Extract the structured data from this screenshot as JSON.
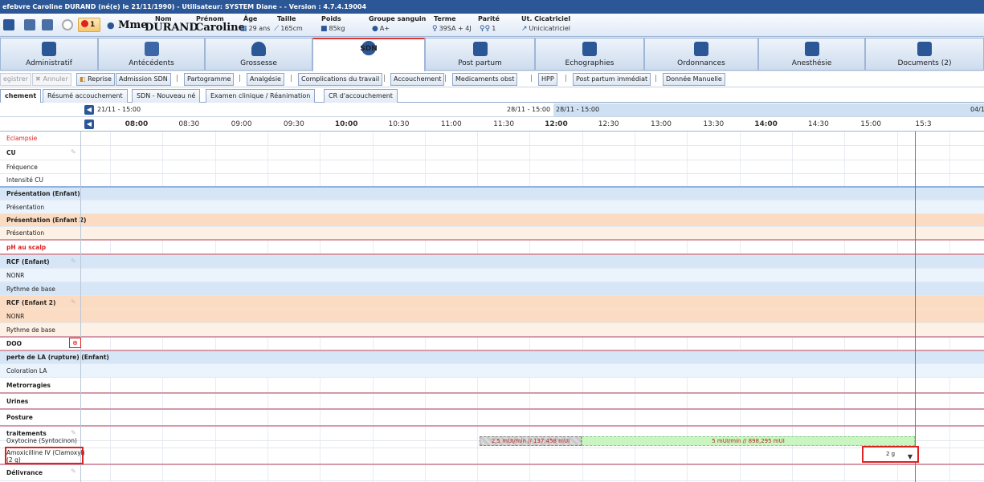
{
  "window": {
    "title": "efebvre Caroline DURAND (né(e) le 21/11/1990) - Utilisateur: SYSTEM Diane - - Version : 4.7.4.19004"
  },
  "patient": {
    "alert_count": "1",
    "civility": "Mme",
    "nom_label": "Nom",
    "nom": "DURAND",
    "prenom_label": "Prénom",
    "prenom": "Caroline",
    "age_label": "Âge",
    "age": "29 ans",
    "taille_label": "Taille",
    "taille": "165cm",
    "poids_label": "Poids",
    "poids": "85kg",
    "groupe_label": "Groupe sanguin",
    "groupe": "A+",
    "terme_label": "Terme",
    "terme": "39SA + 4J",
    "parite_label": "Parité",
    "parite": "1",
    "uterus_label": "Ut. Cicatriciel",
    "uterus": "Unicicatriciel"
  },
  "main_tabs": [
    {
      "label": "Administratif",
      "icon": "id-card-icon"
    },
    {
      "label": "Antécédents",
      "icon": "clock-calendar-icon"
    },
    {
      "label": "Grossesse",
      "icon": "pregnant-woman-icon"
    },
    {
      "label": "SDN",
      "icon": "footprints-icon"
    },
    {
      "label": "Post partum",
      "icon": "mother-baby-icon"
    },
    {
      "label": "Echographies",
      "icon": "ultrasound-icon"
    },
    {
      "label": "Ordonnances",
      "icon": "medical-cross-icon"
    },
    {
      "label": "Anesthésie",
      "icon": "anesthesia-monitor-icon"
    },
    {
      "label": "Documents (2)",
      "icon": "documents-icon"
    }
  ],
  "actions": {
    "save": "egistrer",
    "cancel": "Annuler",
    "reprise": "Reprise",
    "admission": "Admission SDN",
    "partogramme": "Partogramme",
    "analgesie": "Analgésie",
    "complications": "Complications du travail",
    "accouchement": "Accouchement",
    "medicaments": "Medicaments obst",
    "hpp": "HPP",
    "post_partum": "Post partum immédiat",
    "manuelle": "Donnée Manuelle"
  },
  "sub_tabs": [
    "chement",
    "Résumé accouchement",
    "SDN - Nouveau né",
    "Examen clinique / Réanimation",
    "CR d'accouchement"
  ],
  "timeline": {
    "day1": "21/11 - 15:00",
    "day2_end": "28/11 - 15:00",
    "day2_start": "28/11 - 15:00",
    "day3": "04/1",
    "ticks": [
      {
        "label": "08:00",
        "hour": true
      },
      {
        "label": "08:30",
        "hour": false
      },
      {
        "label": "09:00",
        "hour": false
      },
      {
        "label": "09:30",
        "hour": false
      },
      {
        "label": "10:00",
        "hour": true
      },
      {
        "label": "10:30",
        "hour": false
      },
      {
        "label": "11:00",
        "hour": false
      },
      {
        "label": "11:30",
        "hour": false
      },
      {
        "label": "12:00",
        "hour": true
      },
      {
        "label": "12:30",
        "hour": false
      },
      {
        "label": "13:00",
        "hour": false
      },
      {
        "label": "13:30",
        "hour": false
      },
      {
        "label": "14:00",
        "hour": true
      },
      {
        "label": "14:30",
        "hour": false
      },
      {
        "label": "15:00",
        "hour": false
      },
      {
        "label": "15:3",
        "hour": false
      }
    ]
  },
  "rows": {
    "eclampsie": "Eclampsie",
    "cu": "CU",
    "frequence": "Fréquence",
    "intensite": "Intensité CU",
    "presentation_enfant": "Présentation (Enfant)",
    "presentation": "Présentation",
    "presentation_enfant2": "Présentation (Enfant 2)",
    "presentation2": "Présentation",
    "ph": "pH au scalp",
    "rcf_enfant": "RCF (Enfant)",
    "nonr": "NONR",
    "rythme": "Rythme de base",
    "rcf_enfant2": "RCF (Enfant 2)",
    "nonr2": "NONR",
    "rythme2": "Rythme de base",
    "doo": "DOO",
    "perte_la": "perte de LA (rupture) (Enfant)",
    "coloration": "Coloration LA",
    "metrorragies": "Metrorragies",
    "urines": "Urines",
    "posture": "Posture",
    "traitements": "traitements",
    "oxytocine": "Oxytocine (Syntocinon)",
    "amoxicilline_1": "Amoxicilline IV (Clamoxyl)",
    "amoxicilline_2": "(2 g)",
    "delivrance": "Délivrance"
  },
  "treatment": {
    "bar1": "2,5 mUI/min // 137,458 mUI",
    "bar2": "5 mUI/min // 898,295 mUI",
    "dose": "2 g"
  }
}
